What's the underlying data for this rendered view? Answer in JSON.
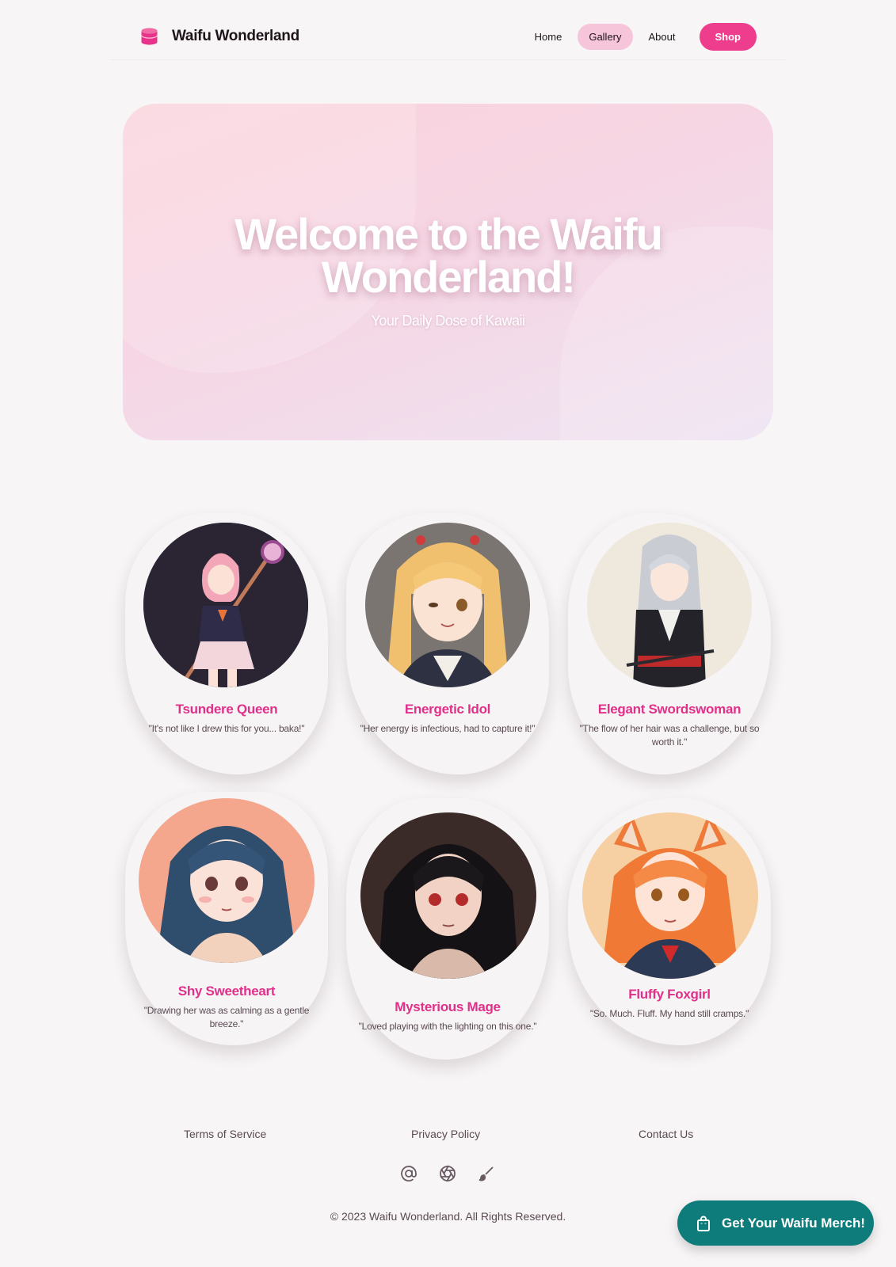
{
  "header": {
    "logo_text": "Waifu Wonderland",
    "nav": [
      {
        "label": "Home",
        "active": false
      },
      {
        "label": "Gallery",
        "active": true
      },
      {
        "label": "About",
        "active": false
      }
    ],
    "shop_label": "Shop"
  },
  "hero": {
    "title_line1": "Welcome to the Waifu",
    "title_line2": "Wonderland!",
    "subtitle": "Your Daily Dose of Kawaii"
  },
  "gallery": [
    {
      "name": "Tsundere Queen",
      "quote": "\"It's not like I drew this for you... baka!\""
    },
    {
      "name": "Energetic Idol",
      "quote": "\"Her energy is infectious, had to capture it!\""
    },
    {
      "name": "Elegant Swordswoman",
      "quote": "\"The flow of her hair was a challenge, but so worth it.\""
    },
    {
      "name": "Shy Sweetheart",
      "quote": "\"Drawing her was as calming as a gentle breeze.\""
    },
    {
      "name": "Mysterious Mage",
      "quote": "\"Loved playing with the lighting on this one.\""
    },
    {
      "name": "Fluffy Foxgirl",
      "quote": "\"So. Much. Fluff. My hand still cramps.\""
    }
  ],
  "footer": {
    "links": [
      "Terms of Service",
      "Privacy Policy",
      "Contact Us"
    ],
    "social_icons": [
      "at-sign-icon",
      "aperture-icon",
      "brush-icon"
    ],
    "copyright": "© 2023 Waifu Wonderland. All Rights Reserved."
  },
  "merch_button": {
    "label": "Get Your Waifu Merch!"
  },
  "colors": {
    "accent_pink": "#ee3d8c",
    "name_pink": "#e0308a",
    "nav_active_bg": "#f7c5d9",
    "merch_teal": "#0e7c7b",
    "page_bg": "#f7f5f6"
  }
}
